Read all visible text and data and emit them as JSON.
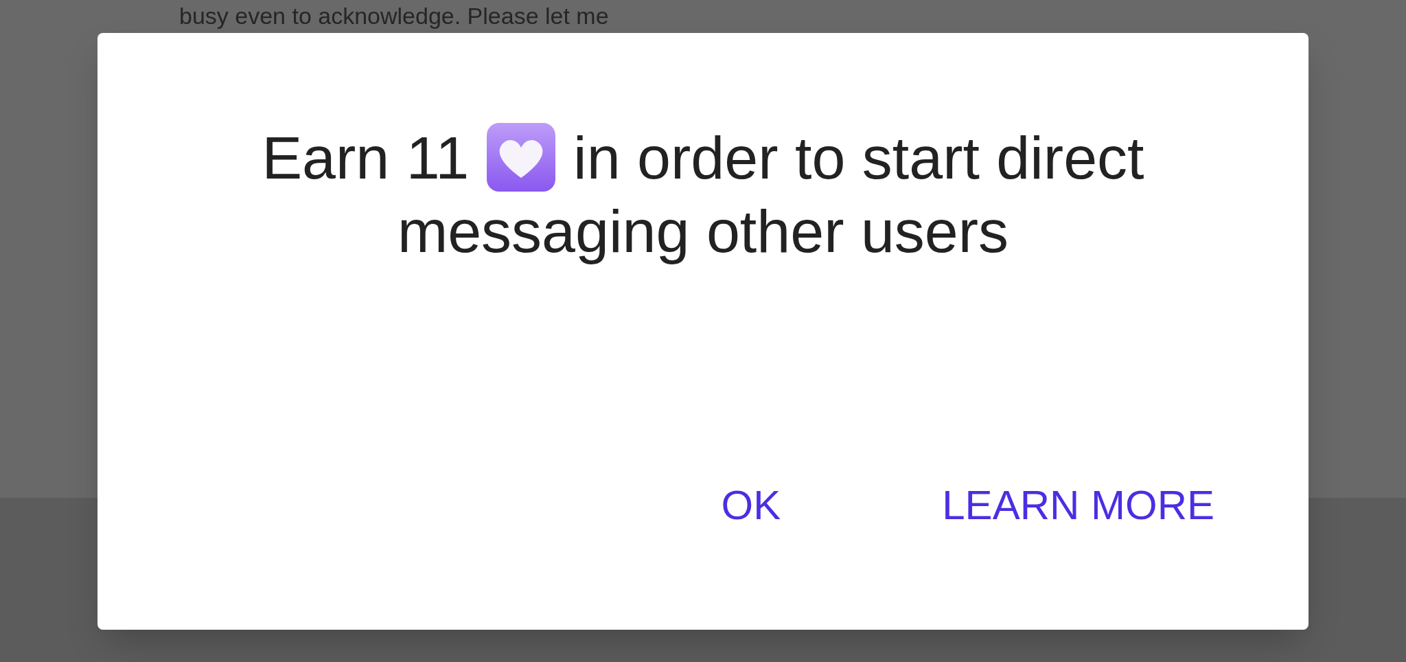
{
  "background": {
    "message_text": "busy even to acknowledge. Please let me"
  },
  "dialog": {
    "message": {
      "line_1_before_icon": "Earn 11",
      "line_1_after_icon": "in order to start direct",
      "line_2": "messaging other users"
    },
    "buttons": [
      "OK",
      "LEARN MORE"
    ]
  }
}
